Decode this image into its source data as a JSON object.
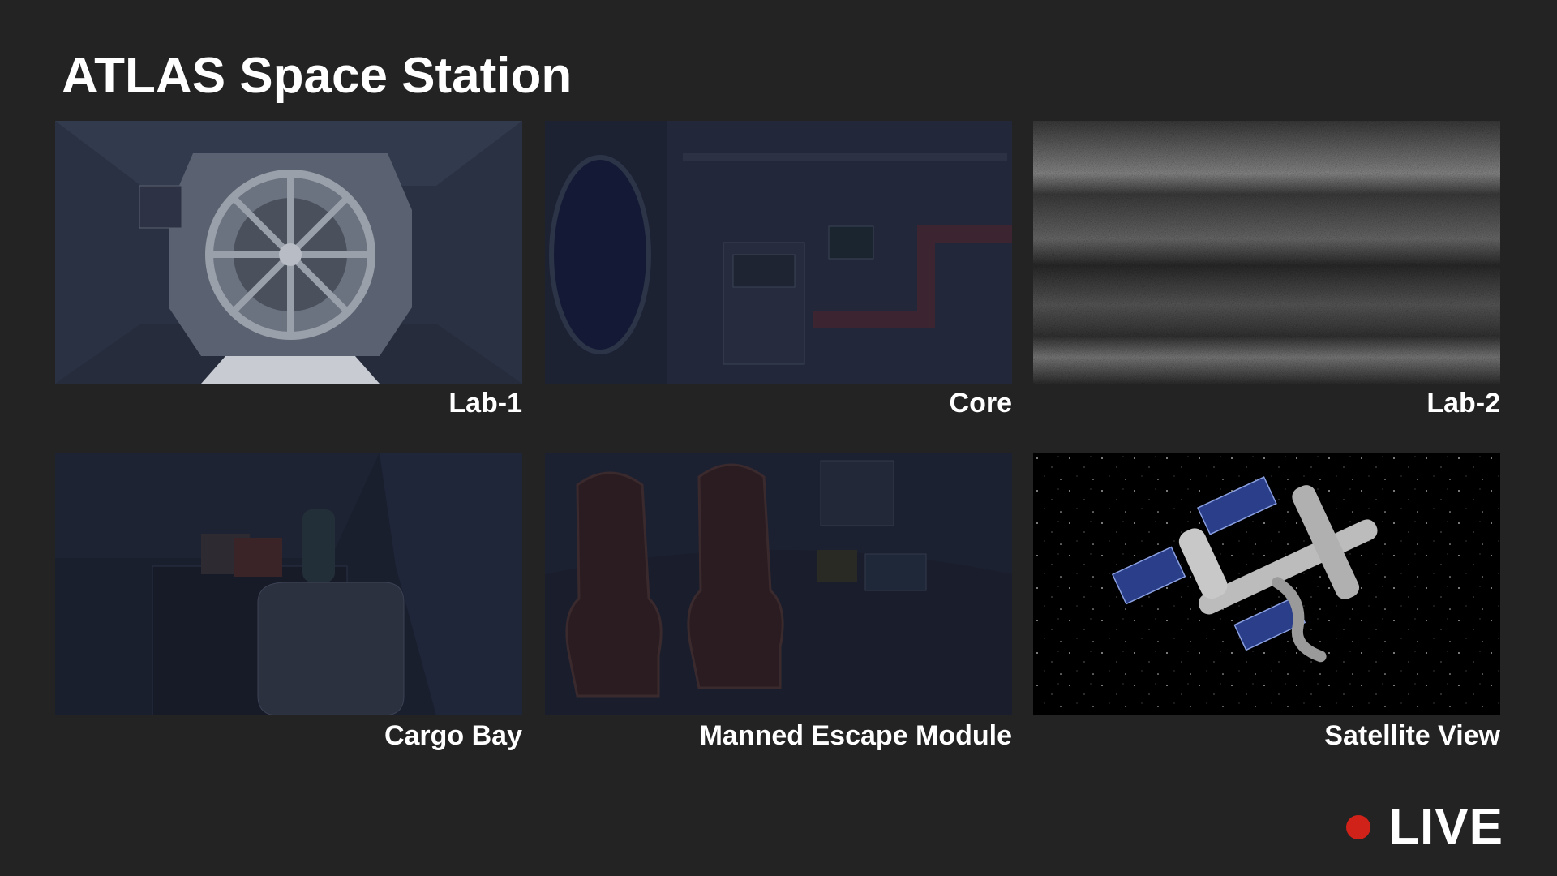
{
  "header": {
    "title": "ATLAS Space Station"
  },
  "cameras": [
    {
      "label": "Lab-1",
      "scene": "hatch-icon"
    },
    {
      "label": "Core",
      "scene": "corridor-icon"
    },
    {
      "label": "Lab-2",
      "scene": "static-noise-icon"
    },
    {
      "label": "Cargo Bay",
      "scene": "cargo-icon"
    },
    {
      "label": "Manned Escape Module",
      "scene": "seats-icon"
    },
    {
      "label": "Satellite View",
      "scene": "station-icon"
    }
  ],
  "status": {
    "live_label": "LIVE",
    "live_color": "#d1221a"
  }
}
